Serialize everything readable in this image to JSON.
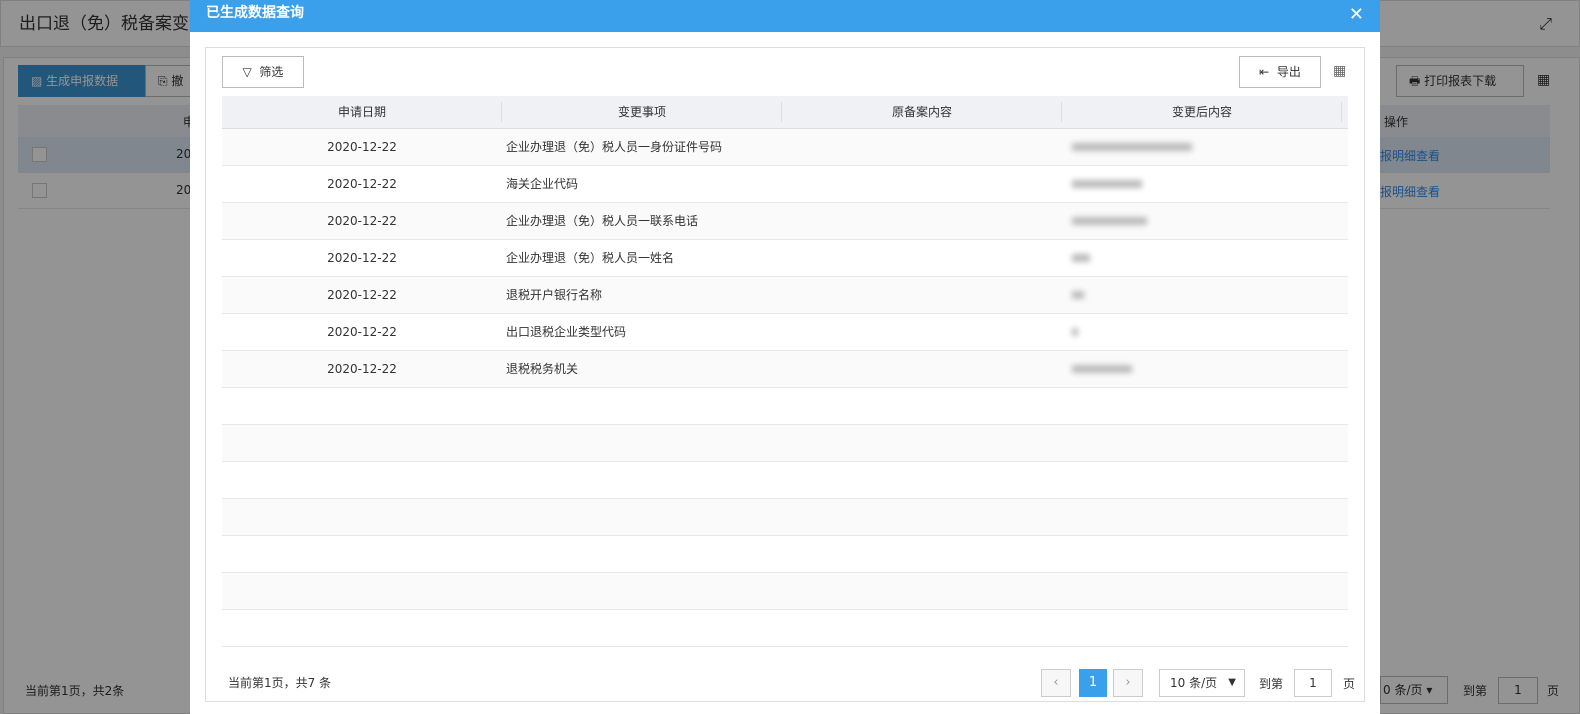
{
  "background": {
    "title": "出口退（免）税备案变更",
    "buttons": {
      "generate": "生成申报数据",
      "second": "撤",
      "print": "打印报表下载"
    },
    "header_col": "申",
    "action_col": "操作",
    "rows": [
      {
        "date": "20",
        "link": "报明细查看"
      },
      {
        "date": "20",
        "link": "报明细查看"
      }
    ],
    "footer": "当前第1页，共2条",
    "page_size": "0 条/页",
    "goto": "到第",
    "goto_value": "1",
    "page_unit": "页"
  },
  "modal": {
    "title": "已生成数据查询",
    "filter_label": "筛选",
    "export_label": "导出",
    "columns": [
      "申请日期",
      "变更事项",
      "原备案内容",
      "变更后内容"
    ],
    "rows": [
      {
        "date": "2020-12-22",
        "item": "企业办理退（免）税人员一身份证件号码"
      },
      {
        "date": "2020-12-22",
        "item": "海关企业代码"
      },
      {
        "date": "2020-12-22",
        "item": "企业办理退（免）税人员一联系电话"
      },
      {
        "date": "2020-12-22",
        "item": "企业办理退（免）税人员一姓名"
      },
      {
        "date": "2020-12-22",
        "item": "退税开户银行名称"
      },
      {
        "date": "2020-12-22",
        "item": "出口退税企业类型代码"
      },
      {
        "date": "2020-12-22",
        "item": "退税税务机关"
      }
    ],
    "footer": "当前第1页，共7 条",
    "pagination": {
      "current": "1",
      "page_size": "10 条/页",
      "goto": "到第",
      "goto_value": "1",
      "page_unit": "页"
    },
    "accent": "#3aa0eb"
  }
}
